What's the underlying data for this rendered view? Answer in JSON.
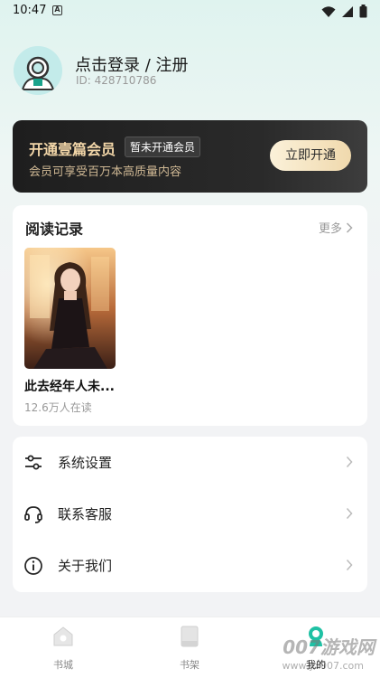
{
  "status_bar": {
    "time": "10:47",
    "a_glyph": "A"
  },
  "profile": {
    "login_title": "点击登录 / 注册",
    "user_id": "ID: 428710786"
  },
  "vip": {
    "title": "开通壹篇会员",
    "badge": "暂未开通会员",
    "subtitle": "会员可享受百万本高质量内容",
    "button": "立即开通"
  },
  "history": {
    "title": "阅读记录",
    "more": "更多",
    "books": [
      {
        "title": "此去经年人未...",
        "readers": "12.6万人在读"
      }
    ]
  },
  "menu": {
    "items": [
      {
        "label": "系统设置",
        "icon": "sliders-icon"
      },
      {
        "label": "联系客服",
        "icon": "headset-icon"
      },
      {
        "label": "关于我们",
        "icon": "info-icon"
      }
    ]
  },
  "bottom_nav": {
    "items": [
      {
        "label": "书城",
        "icon": "home-icon"
      },
      {
        "label": "书架",
        "icon": "bookshelf-icon"
      },
      {
        "label": "我的",
        "icon": "profile-icon",
        "active": true
      }
    ]
  },
  "watermark": {
    "text": "007游戏网",
    "sub": "www.yx007.com"
  }
}
